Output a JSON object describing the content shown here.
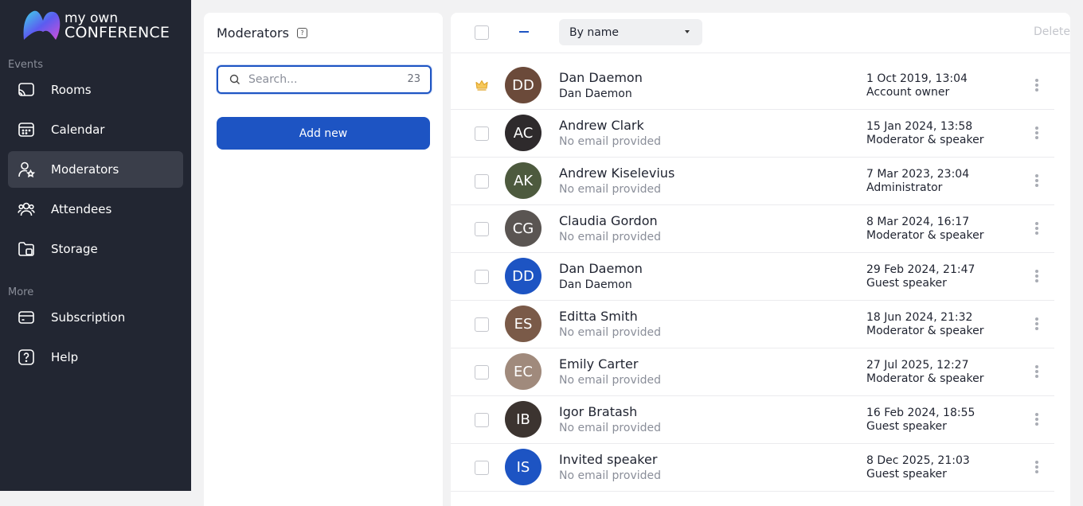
{
  "brand": {
    "line1": "my own",
    "line2": "CONFERENCE"
  },
  "sidebar": {
    "sections": [
      {
        "label": "Events"
      },
      {
        "label": "More"
      }
    ],
    "items": [
      {
        "label": "Rooms",
        "icon": "cast-icon",
        "active": false
      },
      {
        "label": "Calendar",
        "icon": "calendar-icon",
        "active": false
      },
      {
        "label": "Moderators",
        "icon": "user-star-icon",
        "active": true
      },
      {
        "label": "Attendees",
        "icon": "users-icon",
        "active": false
      },
      {
        "label": "Storage",
        "icon": "folder-icon",
        "active": false
      },
      {
        "label": "Subscription",
        "icon": "card-icon",
        "active": false
      },
      {
        "label": "Help",
        "icon": "help-icon",
        "active": false
      }
    ]
  },
  "moderators_panel": {
    "title": "Moderators",
    "help_mark": "?",
    "search": {
      "placeholder": "Search...",
      "value": "",
      "count": "23"
    },
    "add_label": "Add new"
  },
  "list": {
    "sort_label": "By name",
    "delete_label": "Delete",
    "rows": [
      {
        "initials": "DD",
        "name": "Dan Daemon",
        "sub": "Dan Daemon",
        "sub_muted": false,
        "date": "1 Oct 2019, 13:04",
        "role": "Account owner",
        "owner": true,
        "avatar_color": "#6b4a3a"
      },
      {
        "initials": "AC",
        "name": "Andrew Clark",
        "sub": "No email provided",
        "sub_muted": true,
        "date": "15 Jan 2024, 13:58",
        "role": "Moderator & speaker",
        "owner": false,
        "avatar_color": "#2e2a2c"
      },
      {
        "initials": "AK",
        "name": "Andrew Kiselevius",
        "sub": "No email provided",
        "sub_muted": true,
        "date": "7 Mar 2023, 23:04",
        "role": "Administrator",
        "owner": false,
        "avatar_color": "#4d5a3e"
      },
      {
        "initials": "CG",
        "name": "Claudia Gordon",
        "sub": "No email provided",
        "sub_muted": true,
        "date": "8 Mar 2024, 16:17",
        "role": "Moderator & speaker",
        "owner": false,
        "avatar_color": "#5a5552"
      },
      {
        "initials": "DD",
        "name": "Dan Daemon",
        "sub": "Dan Daemon",
        "sub_muted": false,
        "date": "29 Feb 2024, 21:47",
        "role": "Guest speaker",
        "owner": false,
        "avatar_color": "#1d54c3"
      },
      {
        "initials": "ES",
        "name": "Editta Smith",
        "sub": "No email provided",
        "sub_muted": true,
        "date": "18 Jun 2024, 21:32",
        "role": "Moderator & speaker",
        "owner": false,
        "avatar_color": "#7a5a48"
      },
      {
        "initials": "EC",
        "name": "Emily Carter",
        "sub": "No email provided",
        "sub_muted": true,
        "date": "27 Jul 2025, 12:27",
        "role": "Moderator & speaker",
        "owner": false,
        "avatar_color": "#a08a7c"
      },
      {
        "initials": "IB",
        "name": "Igor Bratash",
        "sub": "No email provided",
        "sub_muted": true,
        "date": "16 Feb 2024, 18:55",
        "role": "Guest speaker",
        "owner": false,
        "avatar_color": "#3c3430"
      },
      {
        "initials": "IS",
        "name": "Invited speaker",
        "sub": "No email provided",
        "sub_muted": true,
        "date": "8 Dec 2025, 21:03",
        "role": "Guest speaker",
        "owner": false,
        "avatar_color": "#1d54c3"
      }
    ]
  }
}
